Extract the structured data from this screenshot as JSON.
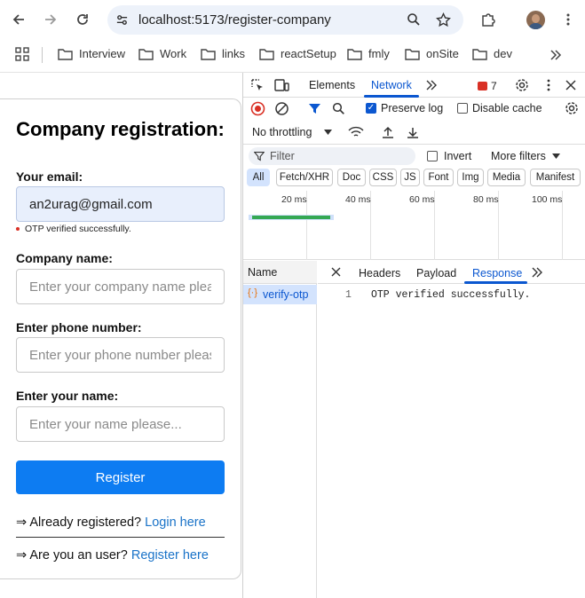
{
  "browser": {
    "url": "localhost:5173/register-company",
    "bookmarks": [
      "Interview",
      "Work",
      "links",
      "reactSetup",
      "fmly",
      "onSite",
      "dev"
    ]
  },
  "form": {
    "title": "Company registration:",
    "email_label": "Your email:",
    "email_value": "an2urag@gmail.com",
    "otp_note": "OTP verified successfully.",
    "company_label": "Company name:",
    "company_placeholder": "Enter your company name please...",
    "phone_label": "Enter phone number:",
    "phone_placeholder": "Enter your phone number please...",
    "name_label": "Enter your name:",
    "name_placeholder": "Enter your name please...",
    "register_button": "Register",
    "already_prefix": "⇒ Already registered?",
    "login_link": "Login here",
    "user_prefix": "⇒ Are you an user?",
    "register_link": "Register here"
  },
  "devtools": {
    "tabs": [
      "Elements",
      "Network"
    ],
    "active_tab": "Network",
    "issues_count": "7",
    "preserve_log": "Preserve log",
    "preserve_log_checked": true,
    "disable_cache": "Disable cache",
    "disable_cache_checked": false,
    "throttling": "No throttling",
    "filter_placeholder": "Filter",
    "invert": "Invert",
    "more_filters": "More filters",
    "type_filters": [
      "All",
      "Fetch/XHR",
      "Doc",
      "CSS",
      "JS",
      "Font",
      "Img",
      "Media",
      "Manifest"
    ],
    "timeline_ticks": [
      "20 ms",
      "40 ms",
      "60 ms",
      "80 ms",
      "100 ms"
    ],
    "name_header": "Name",
    "request_name": "verify-otp",
    "detail_tabs": [
      "Headers",
      "Payload",
      "Response"
    ],
    "active_detail_tab": "Response",
    "response_line_number": "1",
    "response_body": "OTP verified successfully."
  },
  "colors": {
    "accent": "#0b57d0",
    "register_button": "#0d7cf2",
    "link": "#1a73c8",
    "filled_input": "#e8effc"
  }
}
